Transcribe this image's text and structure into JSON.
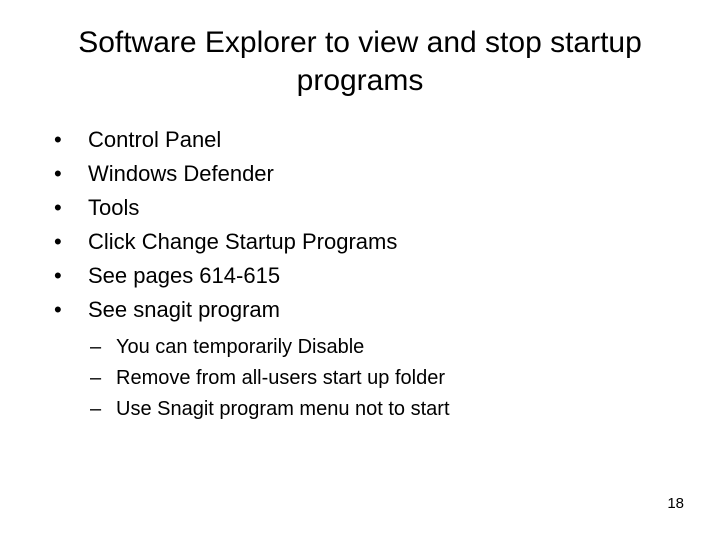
{
  "title": "Software Explorer to view and stop startup programs",
  "bullets": {
    "b0": "Control Panel",
    "b1": "Windows Defender",
    "b2": "Tools",
    "b3": "Click Change Startup Programs",
    "b4": "See pages 614-615",
    "b5": "See snagit program"
  },
  "subbullets": {
    "s0": "You can temporarily Disable",
    "s1": "Remove from all-users start up folder",
    "s2": "Use Snagit program menu not to start"
  },
  "page_number": "18"
}
